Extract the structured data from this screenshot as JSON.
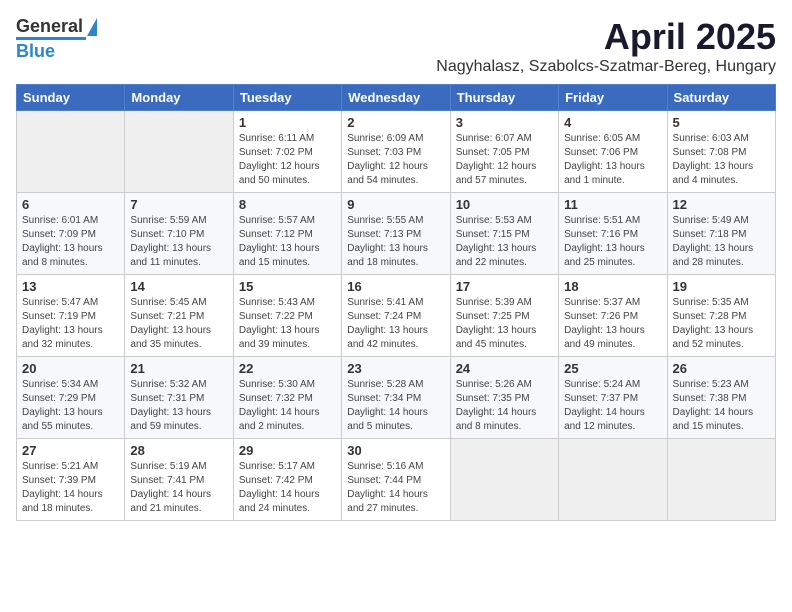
{
  "logo": {
    "line1": "General",
    "line2": "Blue"
  },
  "title": "April 2025",
  "subtitle": "Nagyhalasz, Szabolcs-Szatmar-Bereg, Hungary",
  "headers": [
    "Sunday",
    "Monday",
    "Tuesday",
    "Wednesday",
    "Thursday",
    "Friday",
    "Saturday"
  ],
  "weeks": [
    [
      {
        "day": "",
        "info": ""
      },
      {
        "day": "",
        "info": ""
      },
      {
        "day": "1",
        "info": "Sunrise: 6:11 AM\nSunset: 7:02 PM\nDaylight: 12 hours\nand 50 minutes."
      },
      {
        "day": "2",
        "info": "Sunrise: 6:09 AM\nSunset: 7:03 PM\nDaylight: 12 hours\nand 54 minutes."
      },
      {
        "day": "3",
        "info": "Sunrise: 6:07 AM\nSunset: 7:05 PM\nDaylight: 12 hours\nand 57 minutes."
      },
      {
        "day": "4",
        "info": "Sunrise: 6:05 AM\nSunset: 7:06 PM\nDaylight: 13 hours\nand 1 minute."
      },
      {
        "day": "5",
        "info": "Sunrise: 6:03 AM\nSunset: 7:08 PM\nDaylight: 13 hours\nand 4 minutes."
      }
    ],
    [
      {
        "day": "6",
        "info": "Sunrise: 6:01 AM\nSunset: 7:09 PM\nDaylight: 13 hours\nand 8 minutes."
      },
      {
        "day": "7",
        "info": "Sunrise: 5:59 AM\nSunset: 7:10 PM\nDaylight: 13 hours\nand 11 minutes."
      },
      {
        "day": "8",
        "info": "Sunrise: 5:57 AM\nSunset: 7:12 PM\nDaylight: 13 hours\nand 15 minutes."
      },
      {
        "day": "9",
        "info": "Sunrise: 5:55 AM\nSunset: 7:13 PM\nDaylight: 13 hours\nand 18 minutes."
      },
      {
        "day": "10",
        "info": "Sunrise: 5:53 AM\nSunset: 7:15 PM\nDaylight: 13 hours\nand 22 minutes."
      },
      {
        "day": "11",
        "info": "Sunrise: 5:51 AM\nSunset: 7:16 PM\nDaylight: 13 hours\nand 25 minutes."
      },
      {
        "day": "12",
        "info": "Sunrise: 5:49 AM\nSunset: 7:18 PM\nDaylight: 13 hours\nand 28 minutes."
      }
    ],
    [
      {
        "day": "13",
        "info": "Sunrise: 5:47 AM\nSunset: 7:19 PM\nDaylight: 13 hours\nand 32 minutes."
      },
      {
        "day": "14",
        "info": "Sunrise: 5:45 AM\nSunset: 7:21 PM\nDaylight: 13 hours\nand 35 minutes."
      },
      {
        "day": "15",
        "info": "Sunrise: 5:43 AM\nSunset: 7:22 PM\nDaylight: 13 hours\nand 39 minutes."
      },
      {
        "day": "16",
        "info": "Sunrise: 5:41 AM\nSunset: 7:24 PM\nDaylight: 13 hours\nand 42 minutes."
      },
      {
        "day": "17",
        "info": "Sunrise: 5:39 AM\nSunset: 7:25 PM\nDaylight: 13 hours\nand 45 minutes."
      },
      {
        "day": "18",
        "info": "Sunrise: 5:37 AM\nSunset: 7:26 PM\nDaylight: 13 hours\nand 49 minutes."
      },
      {
        "day": "19",
        "info": "Sunrise: 5:35 AM\nSunset: 7:28 PM\nDaylight: 13 hours\nand 52 minutes."
      }
    ],
    [
      {
        "day": "20",
        "info": "Sunrise: 5:34 AM\nSunset: 7:29 PM\nDaylight: 13 hours\nand 55 minutes."
      },
      {
        "day": "21",
        "info": "Sunrise: 5:32 AM\nSunset: 7:31 PM\nDaylight: 13 hours\nand 59 minutes."
      },
      {
        "day": "22",
        "info": "Sunrise: 5:30 AM\nSunset: 7:32 PM\nDaylight: 14 hours\nand 2 minutes."
      },
      {
        "day": "23",
        "info": "Sunrise: 5:28 AM\nSunset: 7:34 PM\nDaylight: 14 hours\nand 5 minutes."
      },
      {
        "day": "24",
        "info": "Sunrise: 5:26 AM\nSunset: 7:35 PM\nDaylight: 14 hours\nand 8 minutes."
      },
      {
        "day": "25",
        "info": "Sunrise: 5:24 AM\nSunset: 7:37 PM\nDaylight: 14 hours\nand 12 minutes."
      },
      {
        "day": "26",
        "info": "Sunrise: 5:23 AM\nSunset: 7:38 PM\nDaylight: 14 hours\nand 15 minutes."
      }
    ],
    [
      {
        "day": "27",
        "info": "Sunrise: 5:21 AM\nSunset: 7:39 PM\nDaylight: 14 hours\nand 18 minutes."
      },
      {
        "day": "28",
        "info": "Sunrise: 5:19 AM\nSunset: 7:41 PM\nDaylight: 14 hours\nand 21 minutes."
      },
      {
        "day": "29",
        "info": "Sunrise: 5:17 AM\nSunset: 7:42 PM\nDaylight: 14 hours\nand 24 minutes."
      },
      {
        "day": "30",
        "info": "Sunrise: 5:16 AM\nSunset: 7:44 PM\nDaylight: 14 hours\nand 27 minutes."
      },
      {
        "day": "",
        "info": ""
      },
      {
        "day": "",
        "info": ""
      },
      {
        "day": "",
        "info": ""
      }
    ]
  ]
}
